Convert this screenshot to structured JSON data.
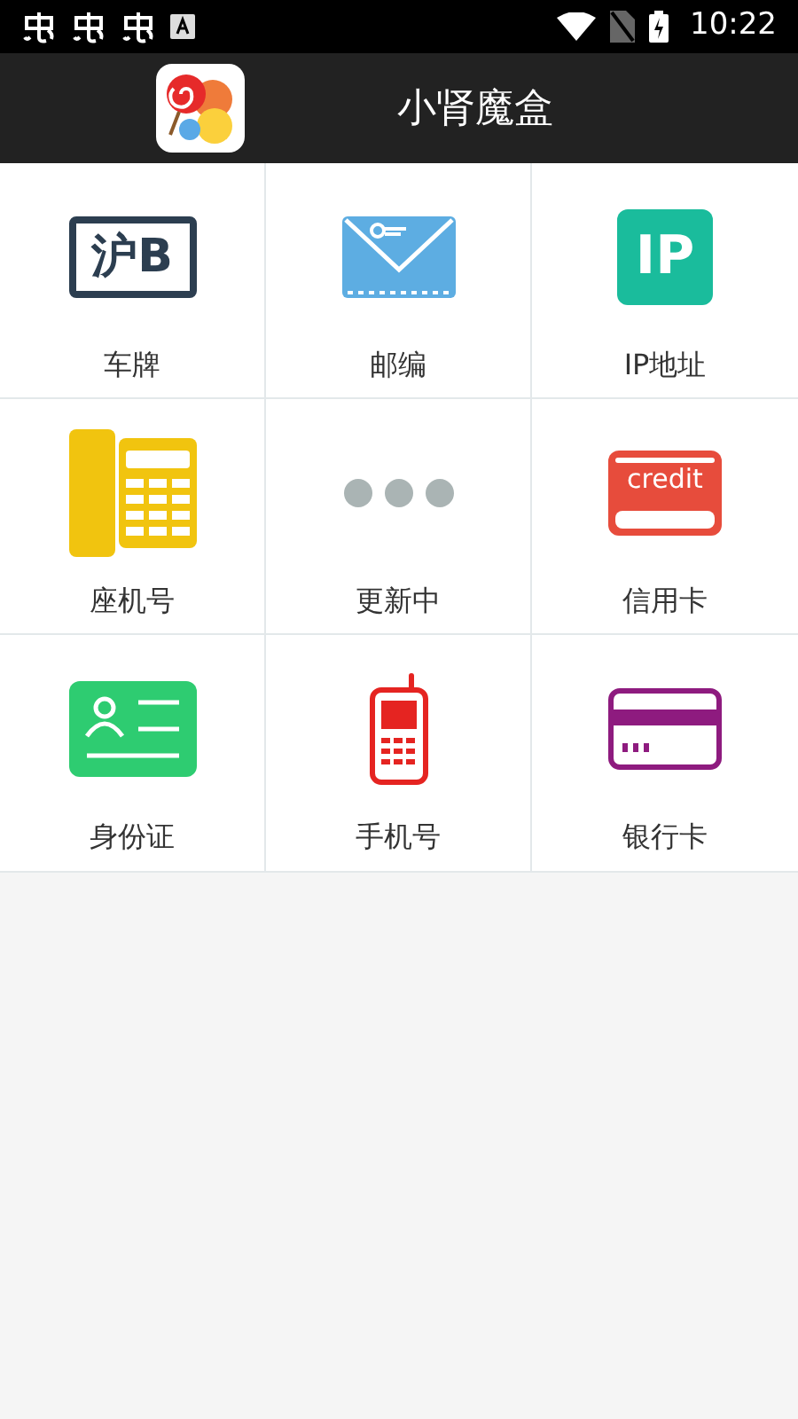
{
  "status_bar": {
    "time": "10:22"
  },
  "app_bar": {
    "title": "小肾魔盒"
  },
  "tiles": [
    {
      "kind": "plate",
      "label": "车牌",
      "icon_text": "沪B"
    },
    {
      "kind": "mail",
      "label": "邮编"
    },
    {
      "kind": "ip",
      "label": "IP地址",
      "icon_text": "IP"
    },
    {
      "kind": "phone",
      "label": "座机号"
    },
    {
      "kind": "dots",
      "label": "更新中"
    },
    {
      "kind": "credit",
      "label": "信用卡",
      "icon_text": "credit"
    },
    {
      "kind": "id",
      "label": "身份证"
    },
    {
      "kind": "mobile",
      "label": "手机号"
    },
    {
      "kind": "bank",
      "label": "银行卡"
    }
  ]
}
